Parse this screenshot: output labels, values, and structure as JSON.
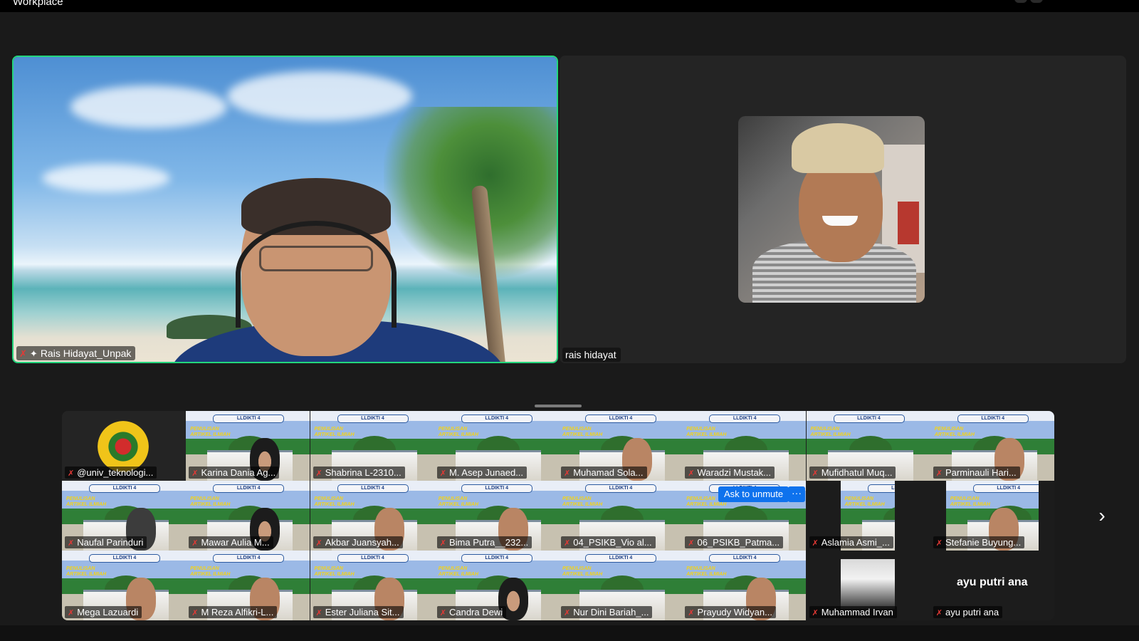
{
  "window": {
    "title": "Workplace"
  },
  "main": {
    "active_speaker": {
      "name": "Rais Hidayat_Unpak",
      "muted": true,
      "pinned": true
    },
    "second_speaker": {
      "name": "rais hidayat"
    }
  },
  "gallery": {
    "poster_banner": "LLDIKTI 4",
    "poster_headline": "PENULISAN ARTIKEL ILMIAH",
    "rows": [
      [
        {
          "name": "@univ_teknologi...",
          "type": "logo"
        },
        {
          "name": "Karina Dania Ag...",
          "type": "poster",
          "face": "hijab"
        },
        {
          "name": "Shabrina L-2310...",
          "type": "poster"
        },
        {
          "name": "M. Asep Junaed...",
          "type": "poster"
        },
        {
          "name": "Muhamad Sola...",
          "type": "poster",
          "face": "person"
        },
        {
          "name": "Waradzi Mustak...",
          "type": "poster"
        },
        {
          "name": "Mufidhatul Muq...",
          "type": "poster"
        },
        {
          "name": "Parminauli Hari...",
          "type": "poster",
          "face": "person"
        }
      ],
      [
        {
          "name": "Naufal Parinduri",
          "type": "poster",
          "face": "dark"
        },
        {
          "name": "Mawar Aulia M...",
          "type": "poster",
          "face": "hijab"
        },
        {
          "name": "Akbar Juansyah...",
          "type": "poster",
          "face": "person"
        },
        {
          "name": "Bima Putra__232...",
          "type": "poster",
          "face": "person"
        },
        {
          "name": "04_PSIKB_Vio al...",
          "type": "poster"
        },
        {
          "name": "06_PSIKB_Patma...",
          "type": "poster"
        },
        {
          "name": "Aslamia Asmi_...",
          "type": "narrow"
        },
        {
          "name": "Stefanie Buyung...",
          "type": "narrow-wide",
          "face": "person"
        }
      ],
      [
        {
          "name": "Mega Lazuardi",
          "type": "poster",
          "face": "person"
        },
        {
          "name": "M Reza Alfikri-L...",
          "type": "poster",
          "face": "person"
        },
        {
          "name": "Ester Juliana Sit...",
          "type": "poster",
          "face": "person"
        },
        {
          "name": "Candra Dewi",
          "type": "poster",
          "face": "hijab"
        },
        {
          "name": "Nur Dini Bariah_...",
          "type": "poster"
        },
        {
          "name": "Prayudy Widyan...",
          "type": "poster",
          "face": "person"
        },
        {
          "name": "Muhammad Irvan",
          "type": "photo"
        },
        {
          "name": "ayu putri ana",
          "type": "name-only"
        }
      ]
    ],
    "hover_actions": {
      "ask_unmute": "Ask to unmute",
      "more": "···"
    }
  },
  "icons": {
    "mic_off": "mic-off-icon",
    "pin": "pin-icon",
    "next": "chevron-right-icon"
  },
  "colors": {
    "active_border": "#23d67c",
    "button_blue": "#0e72ed",
    "muted_red": "#e53935"
  }
}
